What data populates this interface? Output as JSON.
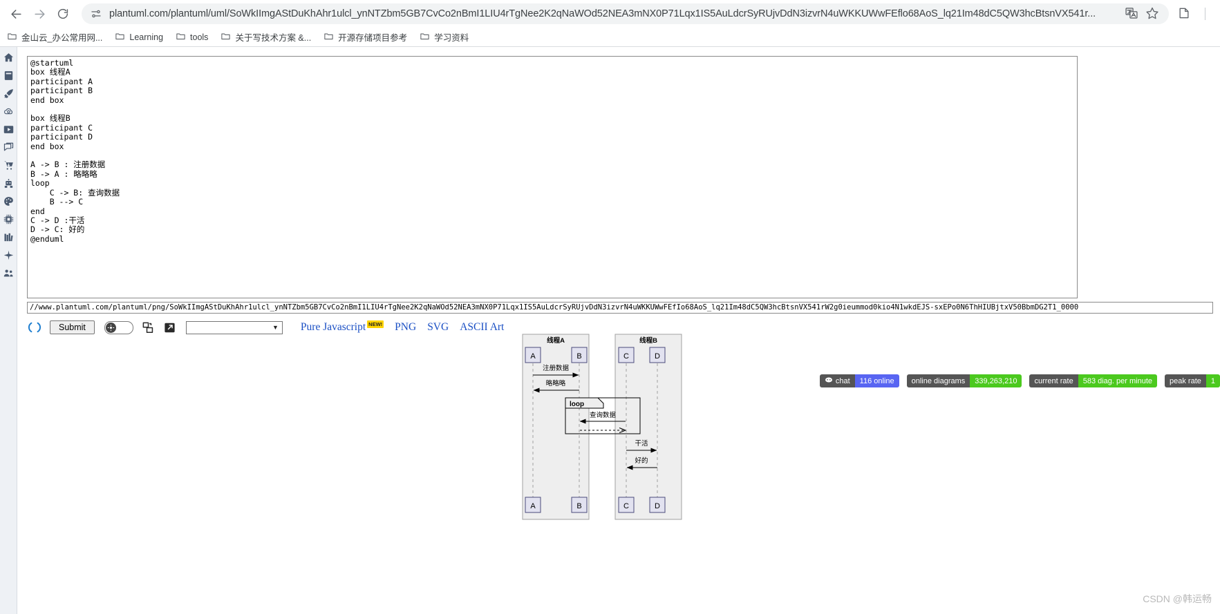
{
  "browser": {
    "back_icon": "back-arrow-icon",
    "forward_icon": "forward-arrow-icon",
    "reload_icon": "reload-icon",
    "omnibox": {
      "site_settings_icon": "site-settings-icon",
      "url": "plantuml.com/plantuml/uml/SoWkIImgAStDuKhAhr1ulcl_ynNTZbm5GB7CvCo2nBmI1LIU4rTgNee2K2qNaWOd52NEA3mNX0P71Lqx1IS5AuLdcrSyRUjvDdN3izvrN4uWKKUWwFEflo68AoS_lq21Im48dC5QW3hcBtsnVX541r...",
      "translate_icon": "translate-icon",
      "bookmark_icon": "star-icon"
    },
    "extensions_icon": "extensions-icon",
    "bookmarks": [
      {
        "label": "金山云_办公常用网...",
        "icon": "folder-icon"
      },
      {
        "label": "Learning",
        "icon": "folder-icon"
      },
      {
        "label": "tools",
        "icon": "folder-icon"
      },
      {
        "label": "关于写技术方案 &...",
        "icon": "folder-icon"
      },
      {
        "label": "开源存储项目参考",
        "icon": "folder-icon"
      },
      {
        "label": "学习资料",
        "icon": "folder-icon"
      }
    ]
  },
  "rail": {
    "items": [
      {
        "icon": "home-icon"
      },
      {
        "icon": "book-icon"
      },
      {
        "icon": "rocket-icon"
      },
      {
        "icon": "cloud-icon"
      },
      {
        "icon": "video-play-icon"
      },
      {
        "icon": "comment-icon"
      },
      {
        "icon": "download-cart-icon"
      },
      {
        "icon": "robot-icon"
      },
      {
        "icon": "palette-icon"
      },
      {
        "icon": "chip-icon"
      },
      {
        "icon": "books-icon"
      },
      {
        "icon": "plane-icon"
      },
      {
        "icon": "people-icon"
      }
    ]
  },
  "editor": {
    "code": "@startuml\nbox 线程A\nparticipant A\nparticipant B\nend box\n\nbox 线程B\nparticipant C\nparticipant D\nend box\n\nA -> B : 注册数据\nB -> A : 略略略\nloop\n    C -> B: 查询数据\n    B --> C\nend\nC -> D :干活\nD -> C: 好的\n@enduml",
    "generated_url": "//www.plantuml.com/plantuml/png/SoWkIImgAStDuKhAhr1ulcl_ynNTZbm5GB7CvCo2nBmI1LIU4rTgNee2K2qNaWOd52NEA3mNX0P71Lqx1IS5AuLdcrSyRUjvDdN3izvrN4uWKKUWwFEfIo68AoS_lq21Im48dC5QW3hcBtsnVX541rW2g0ieummod0kio4N1wkdEJS-sxEPo0N6ThHIUBjtxV50BbmDG2T1_0000"
  },
  "toolbar": {
    "refresh_icon": "refresh-icon",
    "submit_label": "Submit",
    "toggle_icon": "theme-toggle",
    "copy_icon": "copy-icon",
    "paste_icon": "paste-icon",
    "select_value": "",
    "select_caret": "▼",
    "links": [
      {
        "label": "Pure Javascript",
        "badge": "NEW!"
      },
      {
        "label": "PNG",
        "badge": ""
      },
      {
        "label": "SVG",
        "badge": ""
      },
      {
        "label": "ASCII Art",
        "badge": ""
      }
    ]
  },
  "badges": [
    {
      "name": "chat",
      "label": "chat",
      "value": "116 online",
      "icon": "discord-icon",
      "value_color": "#5865f2"
    },
    {
      "name": "online-diagrams",
      "label": "online diagrams",
      "value": "339,263,210",
      "icon": "",
      "value_color": "#4bc91e"
    },
    {
      "name": "current-rate",
      "label": "current rate",
      "value": "583 diag. per minute",
      "icon": "",
      "value_color": "#4bc91e"
    },
    {
      "name": "peak-rate",
      "label": "peak rate",
      "value": "1",
      "icon": "",
      "value_color": "#4bc91e"
    }
  ],
  "diagram": {
    "boxes": [
      {
        "title": "线程A",
        "participants": [
          "A",
          "B"
        ]
      },
      {
        "title": "线程B",
        "participants": [
          "C",
          "D"
        ]
      }
    ],
    "messages": [
      {
        "from": "A",
        "to": "B",
        "label": "注册数据",
        "style": "solid"
      },
      {
        "from": "B",
        "to": "A",
        "label": "略略略",
        "style": "solid"
      },
      {
        "from": "C",
        "to": "B",
        "label": "查询数据",
        "style": "solid"
      },
      {
        "from": "B",
        "to": "C",
        "label": "",
        "style": "dashed"
      },
      {
        "from": "C",
        "to": "D",
        "label": "干活",
        "style": "solid"
      },
      {
        "from": "D",
        "to": "C",
        "label": "好的",
        "style": "solid"
      }
    ],
    "fragment_label": "loop"
  },
  "watermark": "CSDN @韩运畅"
}
